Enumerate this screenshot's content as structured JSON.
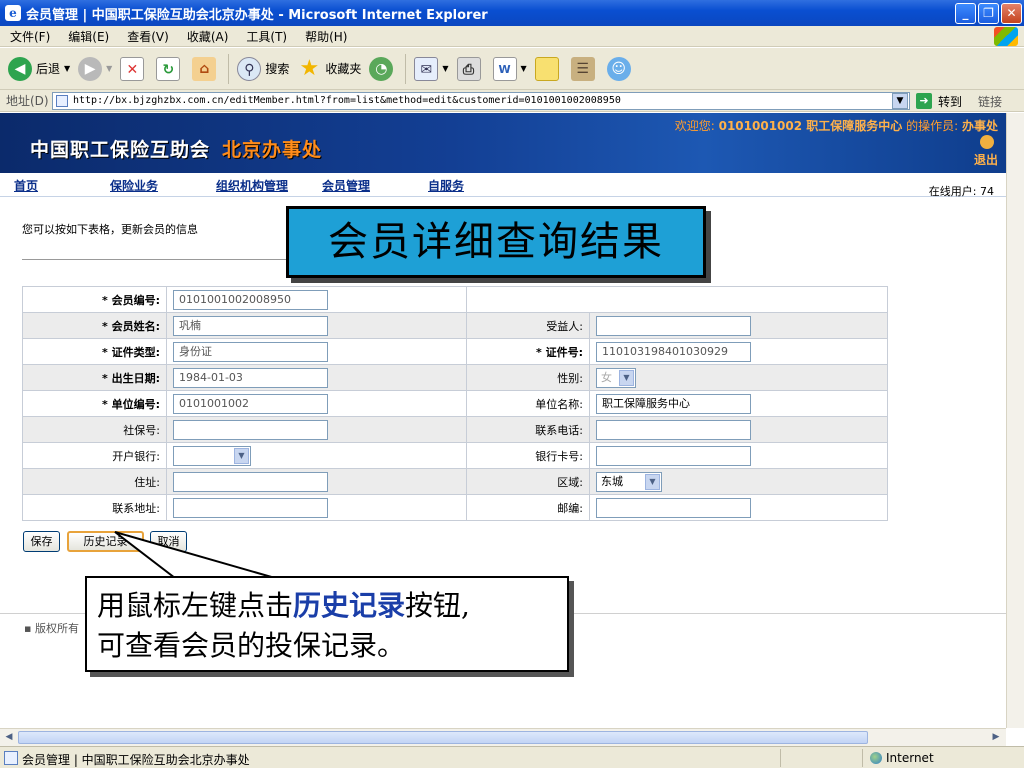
{
  "window": {
    "title": "会员管理 | 中国职工保险互助会北京办事处 - Microsoft Internet Explorer"
  },
  "menu": [
    "文件(F)",
    "编辑(E)",
    "查看(V)",
    "收藏(A)",
    "工具(T)",
    "帮助(H)"
  ],
  "toolbar": {
    "back": "后退",
    "search": "搜索",
    "favorites": "收藏夹"
  },
  "address": {
    "label": "地址(D)",
    "url": "http://bx.bjzghzbx.com.cn/editMember.html?from=list&method=edit&customerid=0101001002008950",
    "go": "转到",
    "links": "链接"
  },
  "banner": {
    "logo1": "中国职工保险互助会",
    "logo2": "北京办事处",
    "welcome_prefix": "欢迎您:",
    "welcome_org": "0101001002 职工保障服务中心",
    "welcome_op_label": "的操作员:",
    "welcome_op": "办事处",
    "logout": "退出"
  },
  "nav": [
    "首页",
    "保险业务",
    "组织机构管理",
    "会员管理",
    "自服务"
  ],
  "online": "在线用户: 74",
  "hint": "您可以按如下表格，更新会员的信息",
  "big_title": "会员详细查询结果",
  "form": {
    "member_no_label": "* 会员编号:",
    "member_no": "0101001002008950",
    "name_label": "* 会员姓名:",
    "name": "巩楠",
    "beneficiary_label": "受益人:",
    "beneficiary": "",
    "id_type_label": "* 证件类型:",
    "id_type": "身份证",
    "id_no_label": "* 证件号:",
    "id_no": "110103198401030929",
    "birth_label": "* 出生日期:",
    "birth": "1984-01-03",
    "gender_label": "性别:",
    "gender": "女",
    "unit_no_label": "* 单位编号:",
    "unit_no": "0101001002",
    "unit_name_label": "单位名称:",
    "unit_name": "职工保障服务中心",
    "social_no_label": "社保号:",
    "phone_label": "联系电话:",
    "bank_label": "开户银行:",
    "card_label": "银行卡号:",
    "address_label": "住址:",
    "district_label": "区域:",
    "district": "东城",
    "contact_label": "联系地址:",
    "postcode_label": "邮编:"
  },
  "buttons": {
    "save": "保存",
    "history": "历史记录",
    "cancel": "取消"
  },
  "footer": "▪ 版权所有",
  "callout": {
    "pre": "用鼠标左键点击",
    "highlight": "历史记录",
    "post": "按钮,",
    "line2": "可查看会员的投保记录。"
  },
  "status": {
    "text": "会员管理 | 中国职工保险互助会北京办事处",
    "zone": "Internet"
  }
}
